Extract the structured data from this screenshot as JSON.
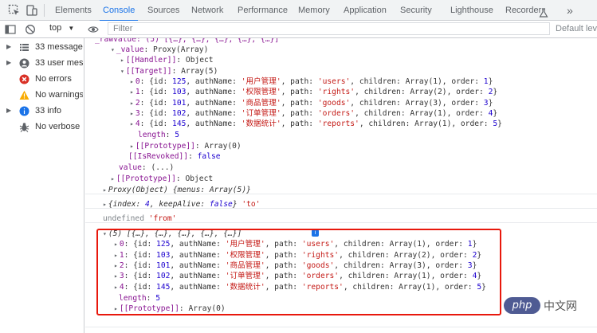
{
  "tabs": [
    "Elements",
    "Console",
    "Sources",
    "Network",
    "Performance",
    "Memory",
    "Application",
    "Security",
    "Lighthouse",
    "Recorder"
  ],
  "more_tabs": "»",
  "toolbar": {
    "context": "top",
    "filter_placeholder": "Filter",
    "levels": "Default levels"
  },
  "sidebar": [
    {
      "label": "33 messages",
      "icon": "list-icon"
    },
    {
      "label": "33 user mes...",
      "icon": "user-icon"
    },
    {
      "label": "No errors",
      "icon": "error-icon"
    },
    {
      "label": "No warnings",
      "icon": "warning-icon"
    },
    {
      "label": "33 info",
      "icon": "info-icon"
    },
    {
      "label": "No verbose",
      "icon": "bug-icon"
    }
  ],
  "lines": [
    {
      "indent": 12,
      "arrow": "",
      "parts": [
        [
          "_rawValue: (5) [{…}, {…}, {…}, {…}, {…}]",
          "k"
        ]
      ]
    },
    {
      "indent": 32,
      "arrow": "▾",
      "parts": [
        [
          "_value",
          "k"
        ],
        [
          ": Proxy(Array)",
          "g"
        ]
      ]
    },
    {
      "indent": 44,
      "arrow": "▸",
      "parts": [
        [
          "[[Handler]]",
          "k"
        ],
        [
          ": Object",
          "g"
        ]
      ]
    },
    {
      "indent": 44,
      "arrow": "▾",
      "parts": [
        [
          "[[Target]]",
          "k"
        ],
        [
          ": Array(5)",
          "g"
        ]
      ]
    },
    {
      "indent": 56,
      "arrow": "▸",
      "parts": [
        [
          "0",
          "k"
        ],
        [
          ": {id: ",
          "g"
        ],
        [
          "125",
          "n"
        ],
        [
          ", authName: ",
          "g"
        ],
        [
          "'用户管理'",
          "s"
        ],
        [
          ", path: ",
          "g"
        ],
        [
          "'users'",
          "s"
        ],
        [
          ", children: Array(1), order: ",
          "g"
        ],
        [
          "1",
          "n"
        ],
        [
          "}",
          "g"
        ]
      ]
    },
    {
      "indent": 56,
      "arrow": "▸",
      "parts": [
        [
          "1",
          "k"
        ],
        [
          ": {id: ",
          "g"
        ],
        [
          "103",
          "n"
        ],
        [
          ", authName: ",
          "g"
        ],
        [
          "'权限管理'",
          "s"
        ],
        [
          ", path: ",
          "g"
        ],
        [
          "'rights'",
          "s"
        ],
        [
          ", children: Array(2), order: ",
          "g"
        ],
        [
          "2",
          "n"
        ],
        [
          "}",
          "g"
        ]
      ]
    },
    {
      "indent": 56,
      "arrow": "▸",
      "parts": [
        [
          "2",
          "k"
        ],
        [
          ": {id: ",
          "g"
        ],
        [
          "101",
          "n"
        ],
        [
          ", authName: ",
          "g"
        ],
        [
          "'商品管理'",
          "s"
        ],
        [
          ", path: ",
          "g"
        ],
        [
          "'goods'",
          "s"
        ],
        [
          ", children: Array(3), order: ",
          "g"
        ],
        [
          "3",
          "n"
        ],
        [
          "}",
          "g"
        ]
      ]
    },
    {
      "indent": 56,
      "arrow": "▸",
      "parts": [
        [
          "3",
          "k"
        ],
        [
          ": {id: ",
          "g"
        ],
        [
          "102",
          "n"
        ],
        [
          ", authName: ",
          "g"
        ],
        [
          "'订单管理'",
          "s"
        ],
        [
          ", path: ",
          "g"
        ],
        [
          "'orders'",
          "s"
        ],
        [
          ", children: Array(1), order: ",
          "g"
        ],
        [
          "4",
          "n"
        ],
        [
          "}",
          "g"
        ]
      ]
    },
    {
      "indent": 56,
      "arrow": "▸",
      "parts": [
        [
          "4",
          "k"
        ],
        [
          ": {id: ",
          "g"
        ],
        [
          "145",
          "n"
        ],
        [
          ", authName: ",
          "g"
        ],
        [
          "'数据统计'",
          "s"
        ],
        [
          ", path: ",
          "g"
        ],
        [
          "'reports'",
          "s"
        ],
        [
          ", children: Array(1), order: ",
          "g"
        ],
        [
          "5",
          "n"
        ],
        [
          "}",
          "g"
        ]
      ]
    },
    {
      "indent": 66,
      "arrow": "",
      "parts": [
        [
          "length",
          "k"
        ],
        [
          ": ",
          "g"
        ],
        [
          "5",
          "n"
        ]
      ]
    },
    {
      "indent": 56,
      "arrow": "▸",
      "parts": [
        [
          "[[Prototype]]",
          "k"
        ],
        [
          ": Array(0)",
          "g"
        ]
      ]
    },
    {
      "indent": 54,
      "arrow": "",
      "parts": [
        [
          "[[IsRevoked]]",
          "k"
        ],
        [
          ": ",
          "g"
        ],
        [
          "false",
          "n"
        ]
      ]
    },
    {
      "indent": 42,
      "arrow": "",
      "parts": [
        [
          "value",
          "k"
        ],
        [
          ": (...)",
          "g"
        ]
      ]
    },
    {
      "indent": 32,
      "arrow": "▸",
      "parts": [
        [
          "[[Prototype]]",
          "k"
        ],
        [
          ": Object",
          "g"
        ]
      ]
    },
    {
      "indent": 22,
      "arrow": "▸",
      "parts": [
        [
          "Proxy(Object) {menus: Array(5)}",
          "g it"
        ]
      ]
    },
    {
      "indent": 22,
      "arrow": "▸",
      "parts": [
        [
          "{index: ",
          "g it"
        ],
        [
          "4",
          "n it"
        ],
        [
          ", keepAlive: ",
          "g it"
        ],
        [
          "false",
          "n it"
        ],
        [
          "} ",
          "g it"
        ],
        [
          "'to'",
          "s"
        ]
      ]
    },
    {
      "indent": 22,
      "arrow": "",
      "parts": [
        [
          "undefined ",
          "gr"
        ],
        [
          "'from'",
          "s"
        ]
      ]
    },
    {
      "indent": 22,
      "arrow": "▾",
      "parts": [
        [
          "(5) [{…}, {…}, {…}, {…}, {…}]",
          "g it"
        ]
      ]
    },
    {
      "indent": 36,
      "arrow": "▸",
      "parts": [
        [
          "0",
          "k"
        ],
        [
          ": {id: ",
          "g"
        ],
        [
          "125",
          "n"
        ],
        [
          ", authName: ",
          "g"
        ],
        [
          "'用户管理'",
          "s"
        ],
        [
          ", path: ",
          "g"
        ],
        [
          "'users'",
          "s"
        ],
        [
          ", children: Array(1), order: ",
          "g"
        ],
        [
          "1",
          "n"
        ],
        [
          "}",
          "g"
        ]
      ]
    },
    {
      "indent": 36,
      "arrow": "▸",
      "parts": [
        [
          "1",
          "k"
        ],
        [
          ": {id: ",
          "g"
        ],
        [
          "103",
          "n"
        ],
        [
          ", authName: ",
          "g"
        ],
        [
          "'权限管理'",
          "s"
        ],
        [
          ", path: ",
          "g"
        ],
        [
          "'rights'",
          "s"
        ],
        [
          ", children: Array(2), order: ",
          "g"
        ],
        [
          "2",
          "n"
        ],
        [
          "}",
          "g"
        ]
      ]
    },
    {
      "indent": 36,
      "arrow": "▸",
      "parts": [
        [
          "2",
          "k"
        ],
        [
          ": {id: ",
          "g"
        ],
        [
          "101",
          "n"
        ],
        [
          ", authName: ",
          "g"
        ],
        [
          "'商品管理'",
          "s"
        ],
        [
          ", path: ",
          "g"
        ],
        [
          "'goods'",
          "s"
        ],
        [
          ", children: Array(3), order: ",
          "g"
        ],
        [
          "3",
          "n"
        ],
        [
          "}",
          "g"
        ]
      ]
    },
    {
      "indent": 36,
      "arrow": "▸",
      "parts": [
        [
          "3",
          "k"
        ],
        [
          ": {id: ",
          "g"
        ],
        [
          "102",
          "n"
        ],
        [
          ", authName: ",
          "g"
        ],
        [
          "'订单管理'",
          "s"
        ],
        [
          ", path: ",
          "g"
        ],
        [
          "'orders'",
          "s"
        ],
        [
          ", children: Array(1), order: ",
          "g"
        ],
        [
          "4",
          "n"
        ],
        [
          "}",
          "g"
        ]
      ]
    },
    {
      "indent": 36,
      "arrow": "▸",
      "parts": [
        [
          "4",
          "k"
        ],
        [
          ": {id: ",
          "g"
        ],
        [
          "145",
          "n"
        ],
        [
          ", authName: ",
          "g"
        ],
        [
          "'数据统计'",
          "s"
        ],
        [
          ", path: ",
          "g"
        ],
        [
          "'reports'",
          "s"
        ],
        [
          ", children: Array(1), order: ",
          "g"
        ],
        [
          "5",
          "n"
        ],
        [
          "}",
          "g"
        ]
      ]
    },
    {
      "indent": 42,
      "arrow": "",
      "parts": [
        [
          "length",
          "k"
        ],
        [
          ": ",
          "g"
        ],
        [
          "5",
          "n"
        ]
      ]
    },
    {
      "indent": 36,
      "arrow": "▸",
      "parts": [
        [
          "[[Prototype]]",
          "k"
        ],
        [
          ": Array(0)",
          "g"
        ]
      ]
    }
  ],
  "watermark": {
    "logo": "php",
    "text": "中文网"
  },
  "colors": {
    "accent": "#1a73e8",
    "highlight_box": "#e8180c"
  }
}
